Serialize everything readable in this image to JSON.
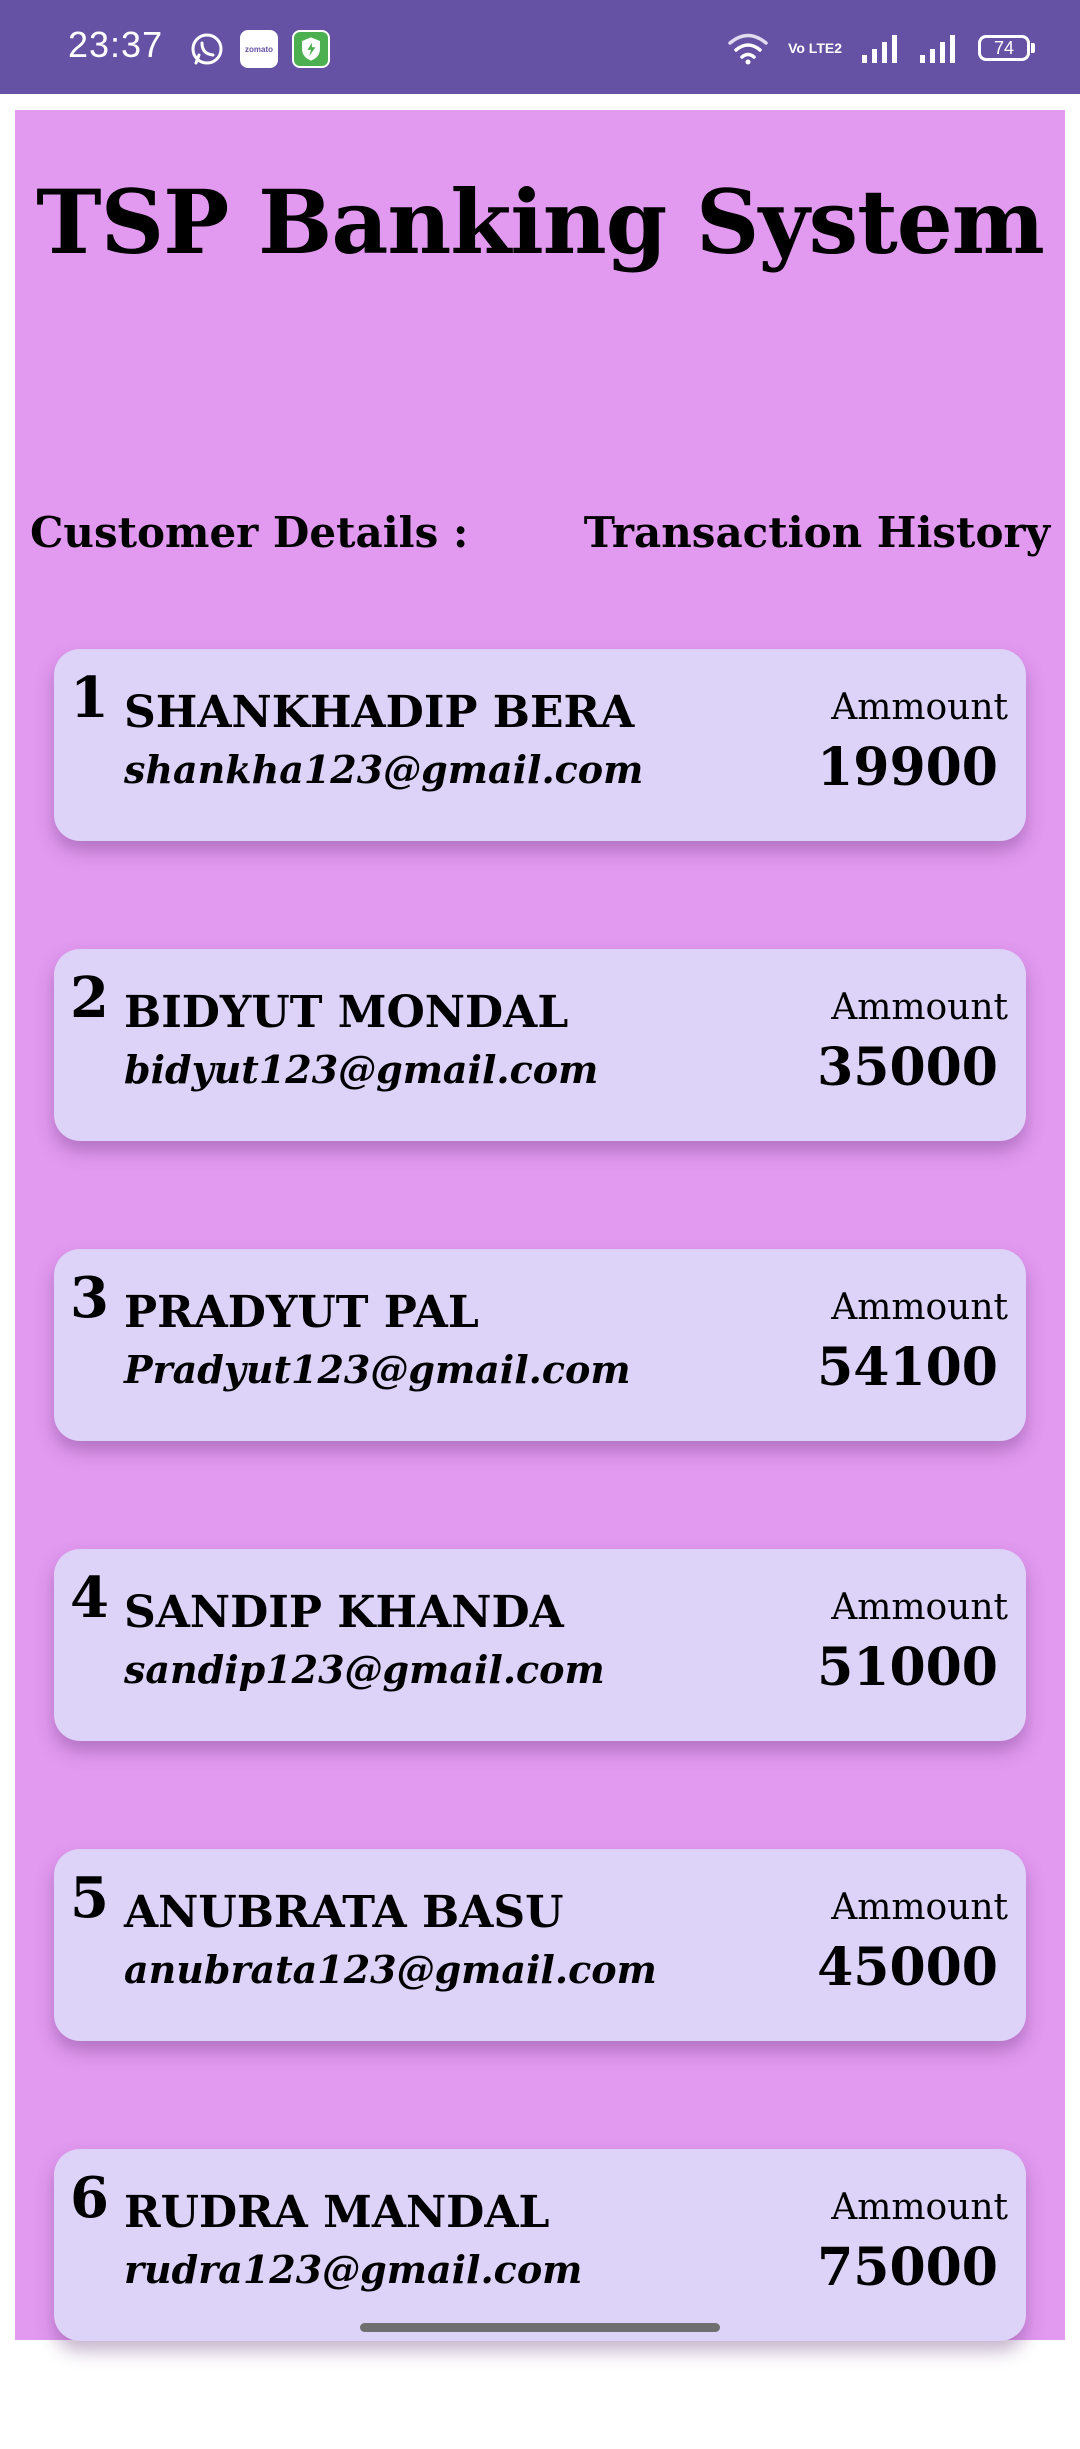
{
  "status_bar": {
    "time": "23:37",
    "app_icons": [
      "whatsapp-icon",
      "zomato-icon",
      "shield-icon"
    ],
    "zomato_label": "zomato",
    "volte": "Vo LTE2",
    "battery": "74",
    "background_color": "#6652a4"
  },
  "app": {
    "title": "TSP Banking System",
    "background_color": "#e29af0",
    "card_color": "#ddd2f7"
  },
  "nav": {
    "customer_details": "Customer Details :",
    "transaction_history": "Transaction History"
  },
  "customers": [
    {
      "index": "1",
      "name": "SHANKHADIP BERA",
      "email": "shankha123@gmail.com",
      "amount_label": "Ammount",
      "amount": "19900"
    },
    {
      "index": "2",
      "name": "BIDYUT MONDAL",
      "email": "bidyut123@gmail.com",
      "amount_label": "Ammount",
      "amount": "35000"
    },
    {
      "index": "3",
      "name": "PRADYUT PAL",
      "email": "Pradyut123@gmail.com",
      "amount_label": "Ammount",
      "amount": "54100"
    },
    {
      "index": "4",
      "name": "SANDIP KHANDA",
      "email": "sandip123@gmail.com",
      "amount_label": "Ammount",
      "amount": "51000"
    },
    {
      "index": "5",
      "name": "ANUBRATA BASU",
      "email": "anubrata123@gmail.com",
      "amount_label": "Ammount",
      "amount": "45000"
    },
    {
      "index": "6",
      "name": "RUDRA MANDAL",
      "email": "rudra123@gmail.com",
      "amount_label": "Ammount",
      "amount": "75000"
    }
  ]
}
